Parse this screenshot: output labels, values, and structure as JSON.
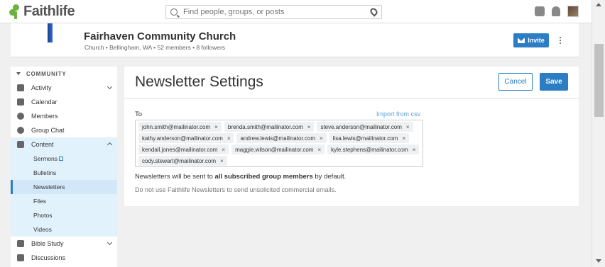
{
  "topbar": {
    "brand": "Faithlife",
    "search_placeholder": "Find people, groups, or posts"
  },
  "group": {
    "name": "Fairhaven Community Church",
    "meta": "Church  •  Bellingham, WA  •  52 members  •  8 followers",
    "invite_label": "Invite"
  },
  "sidebar": {
    "section": "COMMUNITY",
    "items": [
      {
        "label": "Activity",
        "icon": "activity-icon"
      },
      {
        "label": "Calendar",
        "icon": "calendar-icon"
      },
      {
        "label": "Members",
        "icon": "members-icon"
      },
      {
        "label": "Group Chat",
        "icon": "chat-icon"
      },
      {
        "label": "Content",
        "icon": "folder-icon"
      },
      {
        "label": "Sermons"
      },
      {
        "label": "Bulletins"
      },
      {
        "label": "Newsletters"
      },
      {
        "label": "Files"
      },
      {
        "label": "Photos"
      },
      {
        "label": "Videos"
      },
      {
        "label": "Bible Study",
        "icon": "book-icon"
      },
      {
        "label": "Discussions",
        "icon": "discussions-icon"
      }
    ]
  },
  "settings": {
    "title": "Newsletter Settings",
    "cancel_label": "Cancel",
    "save_label": "Save",
    "to_label": "To",
    "import_label": "Import from csv",
    "recipients": [
      "john.smith@mailinator.com",
      "brenda.smith@mailinator.com",
      "steve.anderson@mailinator.com",
      "kathy.anderson@mailinator.com",
      "andrew.lewis@mailinator.com",
      "lisa.lewis@mailinator.com",
      "kendall.jones@mailinator.com",
      "maggie.wilson@mailinator.com",
      "kyle.stephens@mailinator.com",
      "cody.stewart@mailinator.com"
    ],
    "remove_symbol": "×",
    "note_prefix": "Newsletters will be sent to ",
    "note_bold": "all subscribed group members",
    "note_suffix": " by default.",
    "note_warning": "Do not use Faithlife Newsletters to send unsolicited commercial emails."
  }
}
